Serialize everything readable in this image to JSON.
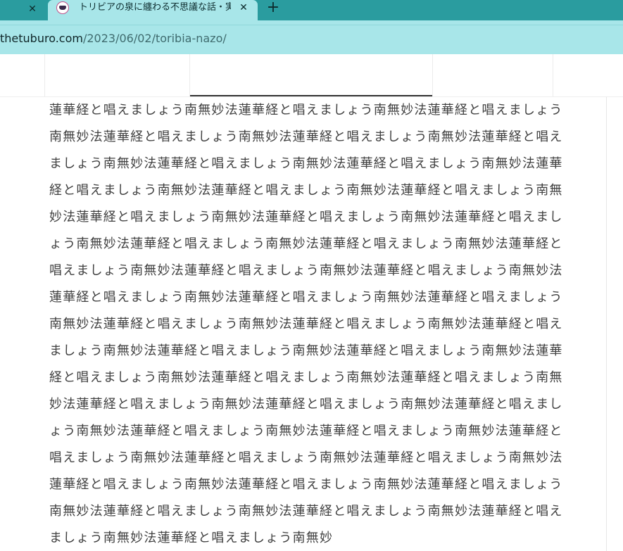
{
  "browser": {
    "tabs": [
      {
        "title": "トリビアの泉に纏わる不思議な話・実話",
        "active": true
      }
    ],
    "close_glyph": "✕",
    "new_tab_glyph": "+",
    "address": {
      "domain": "thetuburo.com",
      "path": "/2023/06/02/toribia-nazo/"
    },
    "accent_color": "#2a9c9f",
    "toolbar_color": "#a8e6e9"
  },
  "article": {
    "body": "蓮華経と唱えましょう南無妙法蓮華経と唱えましょう南無妙法蓮華経と唱えましょう南無妙法蓮華経と唱えましょう南無妙法蓮華経と唱えましょう南無妙法蓮華経と唱えましょう南無妙法蓮華経と唱えましょう南無妙法蓮華経と唱えましょう南無妙法蓮華経と唱えましょう南無妙法蓮華経と唱えましょう南無妙法蓮華経と唱えましょう南無妙法蓮華経と唱えましょう南無妙法蓮華経と唱えましょう南無妙法蓮華経と唱えましょう南無妙法蓮華経と唱えましょう南無妙法蓮華経と唱えましょう南無妙法蓮華経と唱えましょう南無妙法蓮華経と唱えましょう南無妙法蓮華経と唱えましょう南無妙法蓮華経と唱えましょう南無妙法蓮華経と唱えましょう南無妙法蓮華経と唱えましょう南無妙法蓮華経と唱えましょう南無妙法蓮華経と唱えましょう南無妙法蓮華経と唱えましょう南無妙法蓮華経と唱えましょう南無妙法蓮華経と唱えましょう南無妙法蓮華経と唱えましょう南無妙法蓮華経と唱えましょう南無妙法蓮華経と唱えましょう南無妙法蓮華経と唱えましょう南無妙法蓮華経と唱えましょう南無妙法蓮華経と唱えましょう南無妙法蓮華経と唱えましょう南無妙法蓮華経と唱えましょう南無妙法蓮華経と唱えましょう南無妙法蓮華経と唱えましょう南無妙法蓮華経と唱えましょう南無妙法蓮華経と唱えましょう南無妙法蓮華経と唱えましょう南無妙法蓮華経と唱えましょう南無妙法蓮華経と唱えましょう南無妙法蓮華経と唱えましょう南無妙法蓮華経と唱えましょう南無妙法蓮華経と唱えましょう南無妙"
  }
}
